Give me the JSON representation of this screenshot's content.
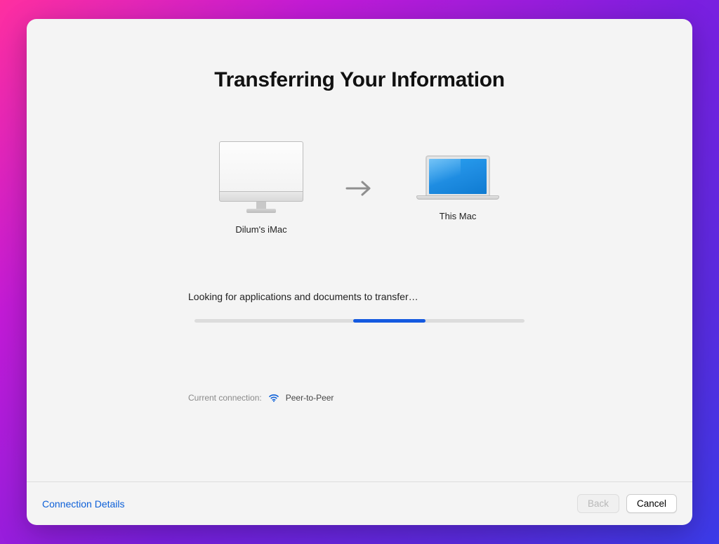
{
  "title": "Transferring Your Information",
  "devices": {
    "source_label": "Dilum's iMac",
    "target_label": "This Mac"
  },
  "status_text": "Looking for applications and documents to transfer…",
  "progress": {
    "indeterminate": true,
    "segment_start_pct": 48,
    "segment_width_pct": 22
  },
  "connection": {
    "label": "Current connection:",
    "type": "Peer-to-Peer",
    "icon": "wifi-icon"
  },
  "footer": {
    "details_link": "Connection Details",
    "back_label": "Back",
    "back_enabled": false,
    "cancel_label": "Cancel"
  },
  "colors": {
    "accent": "#1459e0",
    "link": "#0d60d8"
  }
}
